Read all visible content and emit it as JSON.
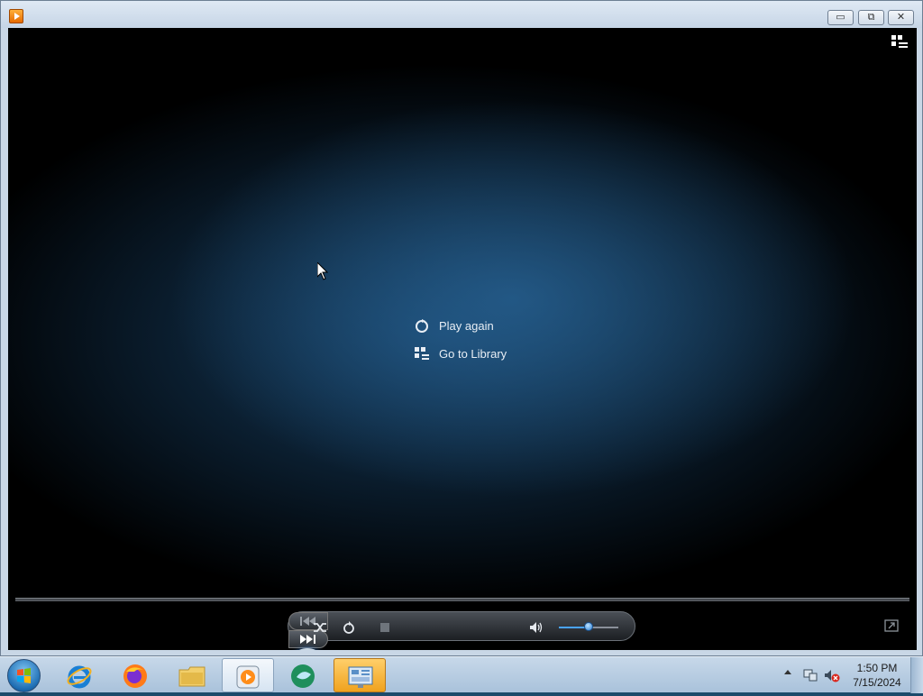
{
  "window": {
    "icon": "windows-media-player-icon",
    "buttons": {
      "minimize": "▭",
      "maximize": "⧉",
      "close": "✕"
    }
  },
  "player": {
    "end_menu": [
      {
        "label": "Play again",
        "icon": "replay-icon"
      },
      {
        "label": "Go to Library",
        "icon": "library-icon"
      }
    ],
    "controls": {
      "shuffle": "shuffle-icon",
      "repeat": "repeat-icon",
      "stop": "stop-icon",
      "previous": "previous-icon",
      "play": "play-icon",
      "next": "next-icon",
      "mute": "speaker-icon",
      "volume_level": 0.5
    },
    "accent_color": "#1e73c8"
  },
  "taskbar": {
    "apps": [
      {
        "name": "Internet Explorer",
        "icon": "internet-explorer-icon"
      },
      {
        "name": "Firefox",
        "icon": "firefox-icon"
      },
      {
        "name": "Windows Explorer",
        "icon": "folder-icon"
      },
      {
        "name": "Windows Media Player",
        "icon": "media-player-icon",
        "state": "active"
      },
      {
        "name": "Spotlight App",
        "icon": "green-app-icon"
      },
      {
        "name": "Control Panel",
        "icon": "control-panel-icon",
        "state": "highlight"
      }
    ],
    "clock": {
      "time": "1:50 PM",
      "date": "7/15/2024"
    }
  }
}
